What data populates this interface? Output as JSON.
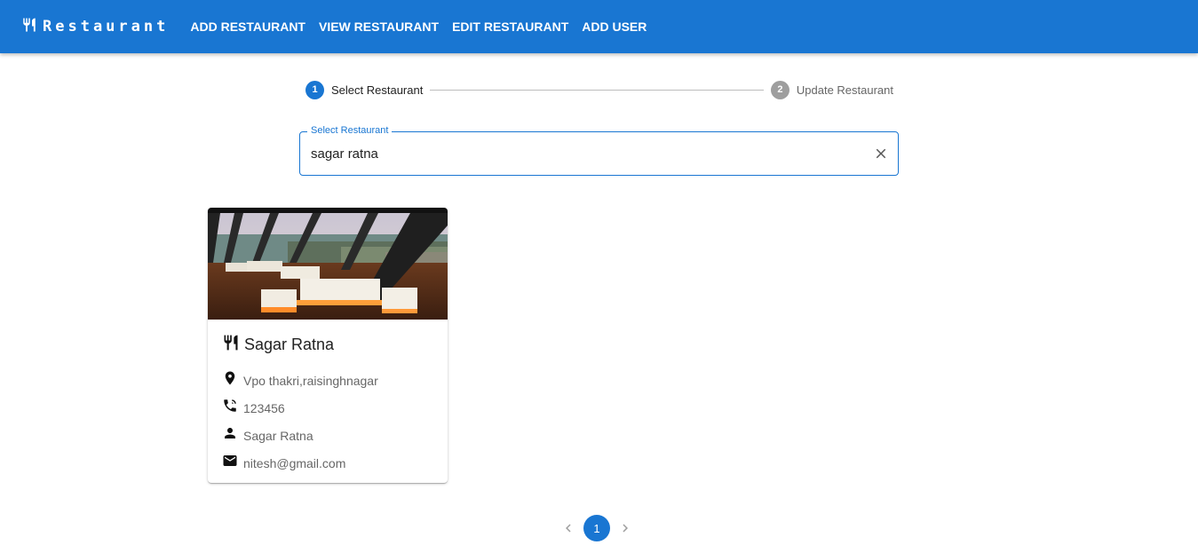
{
  "appbar": {
    "brand": "Restaurant",
    "brand_icon": "restaurant-icon",
    "nav": [
      "ADD RESTAURANT",
      "VIEW RESTAURANT",
      "EDIT RESTAURANT",
      "ADD USER"
    ]
  },
  "stepper": {
    "steps": [
      {
        "number": "1",
        "label": "Select Restaurant",
        "state": "active"
      },
      {
        "number": "2",
        "label": "Update Restaurant",
        "state": "inactive"
      }
    ]
  },
  "select": {
    "label": "Select Restaurant",
    "value": "sagar ratna",
    "clear_icon": "close-icon"
  },
  "card": {
    "image": "restaurant-interior-photo",
    "name": "Sagar Ratna",
    "address": "Vpo thakri,raisinghnagar",
    "phone": "123456",
    "owner": "Sagar Ratna",
    "email": "nitesh@gmail.com",
    "icons": [
      "restaurant-icon",
      "location-pin-icon",
      "phone-icon",
      "person-icon",
      "mail-icon"
    ]
  },
  "pagination": {
    "current": "1"
  },
  "colors": {
    "primary": "#1976d2",
    "inactive_step": "#9e9e9e"
  }
}
